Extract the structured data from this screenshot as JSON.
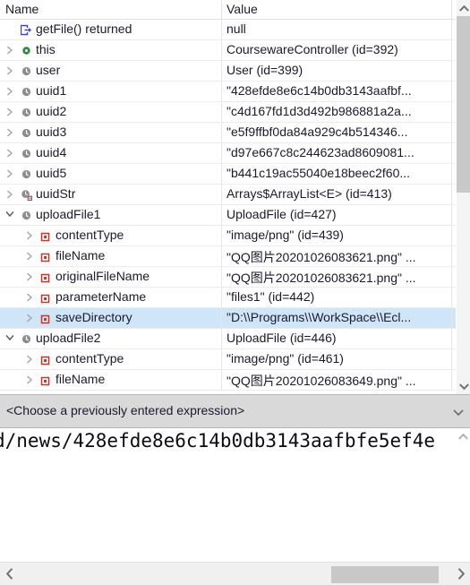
{
  "window": {
    "type": "java-debugger-variables-view"
  },
  "columns": {
    "name_header": "Name",
    "value_header": "Value"
  },
  "rows": [
    {
      "depth": 0,
      "twisty": "none",
      "icon": "method-return-icon",
      "name": "getFile() returned",
      "value": "null",
      "selected": false
    },
    {
      "depth": 0,
      "twisty": "collapsed",
      "icon": "this-object-icon",
      "name": "this",
      "value": "CoursewareController  (id=392)",
      "selected": false
    },
    {
      "depth": 0,
      "twisty": "collapsed",
      "icon": "local-variable-icon",
      "name": "user",
      "value": "User  (id=399)",
      "selected": false
    },
    {
      "depth": 0,
      "twisty": "collapsed",
      "icon": "local-variable-icon",
      "name": "uuid1",
      "value": "\"428efde8e6c14b0db3143aafbf...",
      "selected": false
    },
    {
      "depth": 0,
      "twisty": "collapsed",
      "icon": "local-variable-icon",
      "name": "uuid2",
      "value": "\"c4d167fd1d3d492b986881a2a...",
      "selected": false
    },
    {
      "depth": 0,
      "twisty": "collapsed",
      "icon": "local-variable-icon",
      "name": "uuid3",
      "value": "\"e5f9ffbf0da84a929c4b514346...",
      "selected": false
    },
    {
      "depth": 0,
      "twisty": "collapsed",
      "icon": "local-variable-icon",
      "name": "uuid4",
      "value": "\"d97e667c8c244623ad8609081...",
      "selected": false
    },
    {
      "depth": 0,
      "twisty": "collapsed",
      "icon": "local-variable-icon",
      "name": "uuid5",
      "value": "\"b441c19ac55040e18beec2f60...",
      "selected": false
    },
    {
      "depth": 0,
      "twisty": "collapsed",
      "icon": "collection-variable-icon",
      "name": "uuidStr",
      "value": "Arrays$ArrayList<E>  (id=413)",
      "selected": false
    },
    {
      "depth": 0,
      "twisty": "expanded",
      "icon": "local-variable-icon",
      "name": "uploadFile1",
      "value": "UploadFile  (id=427)",
      "selected": false
    },
    {
      "depth": 1,
      "twisty": "collapsed",
      "icon": "private-field-icon",
      "name": "contentType",
      "value": "\"image/png\" (id=439)",
      "selected": false
    },
    {
      "depth": 1,
      "twisty": "collapsed",
      "icon": "private-field-icon",
      "name": "fileName",
      "value": "\"QQ图片20201026083621.png\" ...",
      "selected": false
    },
    {
      "depth": 1,
      "twisty": "collapsed",
      "icon": "private-field-icon",
      "name": "originalFileName",
      "value": "\"QQ图片20201026083621.png\" ...",
      "selected": false
    },
    {
      "depth": 1,
      "twisty": "collapsed",
      "icon": "private-field-icon",
      "name": "parameterName",
      "value": "\"files1\" (id=442)",
      "selected": false
    },
    {
      "depth": 1,
      "twisty": "collapsed",
      "icon": "private-field-icon",
      "name": "saveDirectory",
      "value": "\"D:\\\\Programs\\\\WorkSpace\\\\Ecl...",
      "selected": true
    },
    {
      "depth": 0,
      "twisty": "expanded",
      "icon": "local-variable-icon",
      "name": "uploadFile2",
      "value": "UploadFile  (id=446)",
      "selected": false
    },
    {
      "depth": 1,
      "twisty": "collapsed",
      "icon": "private-field-icon",
      "name": "contentType",
      "value": "\"image/png\" (id=461)",
      "selected": false
    },
    {
      "depth": 1,
      "twisty": "collapsed",
      "icon": "private-field-icon",
      "name": "fileName",
      "value": "\"QQ图片20201026083649.png\" ...",
      "selected": false
    }
  ],
  "expression_bar": {
    "placeholder": "<Choose a previously entered expression>",
    "dropdown_icon": "chevron-down-icon"
  },
  "detail_pane": {
    "text": "d/news/428efde8e6c14b0db3143aafbfe5ef4e"
  },
  "scrollbars": {
    "tree_vertical_up": "chevron-up-icon",
    "tree_vertical_down": "chevron-down-icon",
    "detail_vertical_up": "chevron-up-icon",
    "detail_horizontal_left": "chevron-left-icon",
    "detail_horizontal_right": "chevron-right-icon"
  },
  "colors": {
    "selection": "#cfe5f8",
    "text": "#1a1a2e",
    "grid_line": "#ececed",
    "expr_bar_bg": "#d9d9d9",
    "scrollbar_thumb": "#c8c8c8",
    "icon_field_red": "#c0392b",
    "icon_this_green": "#2f8a3c",
    "icon_local_gray": "#8a8a8a",
    "icon_return_blue": "#3b3fd8"
  }
}
